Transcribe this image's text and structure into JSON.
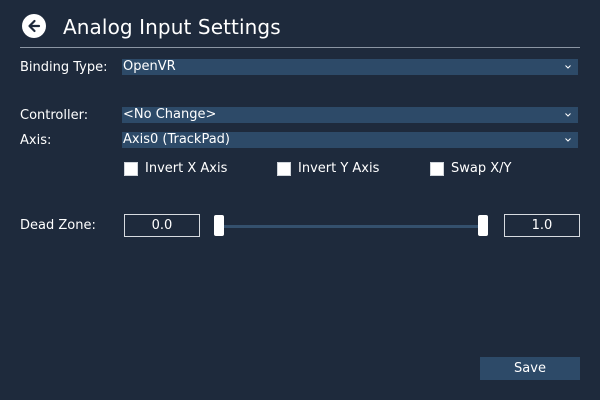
{
  "header": {
    "title": "Analog Input Settings",
    "back_icon": "arrow-left-circle-icon"
  },
  "binding_type": {
    "label": "Binding Type:",
    "value": "OpenVR",
    "icon": "chevron-down-icon"
  },
  "controller": {
    "label": "Controller:",
    "value": "<No Change>",
    "icon": "chevron-down-icon"
  },
  "axis": {
    "label": "Axis:",
    "value": "Axis0 (TrackPad)",
    "icon": "chevron-down-icon"
  },
  "options": [
    {
      "label": "Invert X Axis",
      "checked": false
    },
    {
      "label": "Invert Y Axis",
      "checked": false
    },
    {
      "label": "Swap X/Y",
      "checked": false
    }
  ],
  "dead_zone": {
    "label": "Dead Zone:",
    "min_value": "0.0",
    "max_value": "1.0"
  },
  "footer": {
    "save_label": "Save"
  },
  "colors": {
    "background": "#1e2a3c",
    "field": "#2d4a68",
    "track": "#34506d",
    "text": "#ffffff"
  }
}
